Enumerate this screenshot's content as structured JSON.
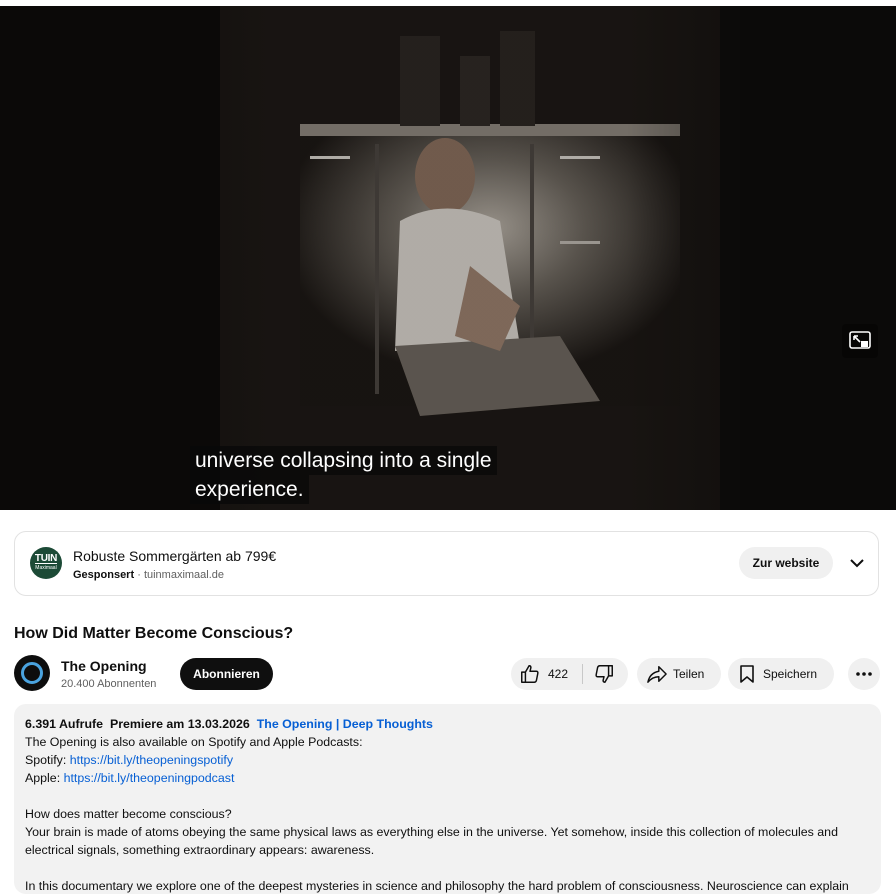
{
  "player": {
    "caption_line1": "universe collapsing into a single",
    "caption_line2": "experience."
  },
  "ad": {
    "logo_text_top": "TUIN",
    "logo_text_bottom": "Maximaal",
    "title": "Robuste Sommergärten ab 799€",
    "sponsored": "Gesponsert",
    "separator": "·",
    "domain": "tuinmaximaal.de",
    "cta": "Zur website"
  },
  "video": {
    "title": "How Did Matter Become Conscious?"
  },
  "channel": {
    "name": "The Opening",
    "subscribers": "20.400 Abonnenten",
    "subscribe_label": "Abonnieren"
  },
  "actions": {
    "like_count": "422",
    "share_label": "Teilen",
    "save_label": "Speichern"
  },
  "description": {
    "views": "6.391 Aufrufe",
    "premiere": "Premiere am 13.03.2026",
    "tag": "The Opening | Deep Thoughts",
    "line1": "The Opening is also available on Spotify and Apple Podcasts:",
    "spotify_label": "Spotify: ",
    "spotify_link": "https://bit.ly/theopeningspotify",
    "apple_label": "Apple: ",
    "apple_link": "https://bit.ly/theopeningpodcast",
    "question": "How does matter become conscious?",
    "para1": "Your brain is made of atoms obeying the same physical laws as everything else in the universe. Yet somehow, inside this collection of molecules and electrical signals, something extraordinary appears: awareness.",
    "para2": "In this documentary we explore one of the deepest mysteries in science and philosophy the hard problem of consciousness. Neuroscience can explain"
  },
  "colors": {
    "link": "#065fd4",
    "subscribe_bg": "#0f0f0f",
    "pill_bg": "#f0f0f0",
    "desc_bg": "#f2f2f2",
    "ad_logo_bg": "#1c4a36"
  }
}
